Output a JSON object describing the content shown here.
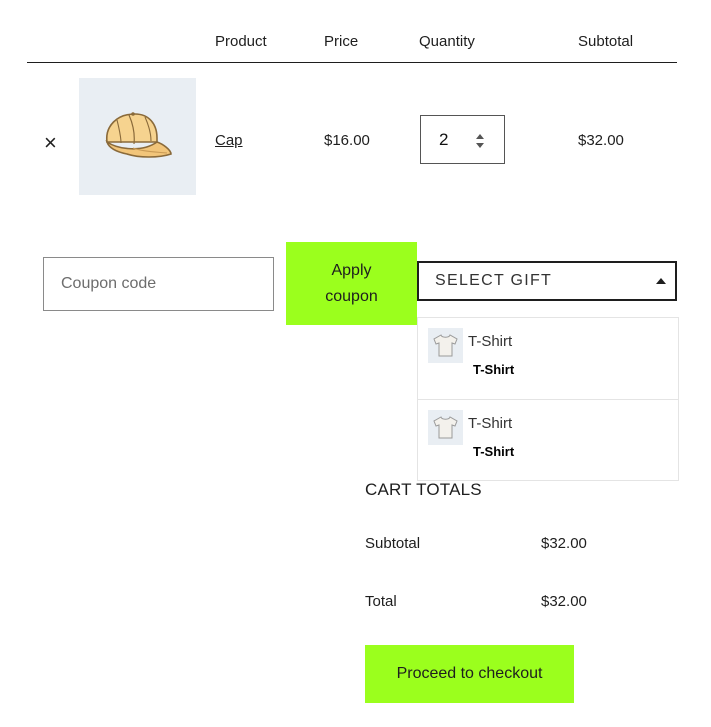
{
  "table": {
    "headers": {
      "product": "Product",
      "price": "Price",
      "quantity": "Quantity",
      "subtotal": "Subtotal"
    },
    "rows": [
      {
        "remove": "×",
        "product": "Cap",
        "price": "$16.00",
        "quantity": "2",
        "subtotal": "$32.00",
        "thumb_icon": "cap-icon"
      }
    ]
  },
  "coupon": {
    "placeholder": "Coupon code",
    "apply_label": "Apply coupon"
  },
  "gift": {
    "select_label": "SELECT GIFT",
    "items": [
      {
        "name": "T-Shirt",
        "name_bold": "T-Shirt",
        "icon": "tshirt-icon"
      },
      {
        "name": "T-Shirt",
        "name_bold": "T-Shirt",
        "icon": "tshirt-icon"
      }
    ]
  },
  "totals": {
    "title": "CART TOTALS",
    "subtotal_label": "Subtotal",
    "subtotal_value": "$32.00",
    "total_label": "Total",
    "total_value": "$32.00",
    "checkout_label": "Proceed to checkout"
  },
  "colors": {
    "accent": "#9bff1d",
    "thumb_bg": "#e9eef3",
    "text": "#1e1e1e"
  }
}
